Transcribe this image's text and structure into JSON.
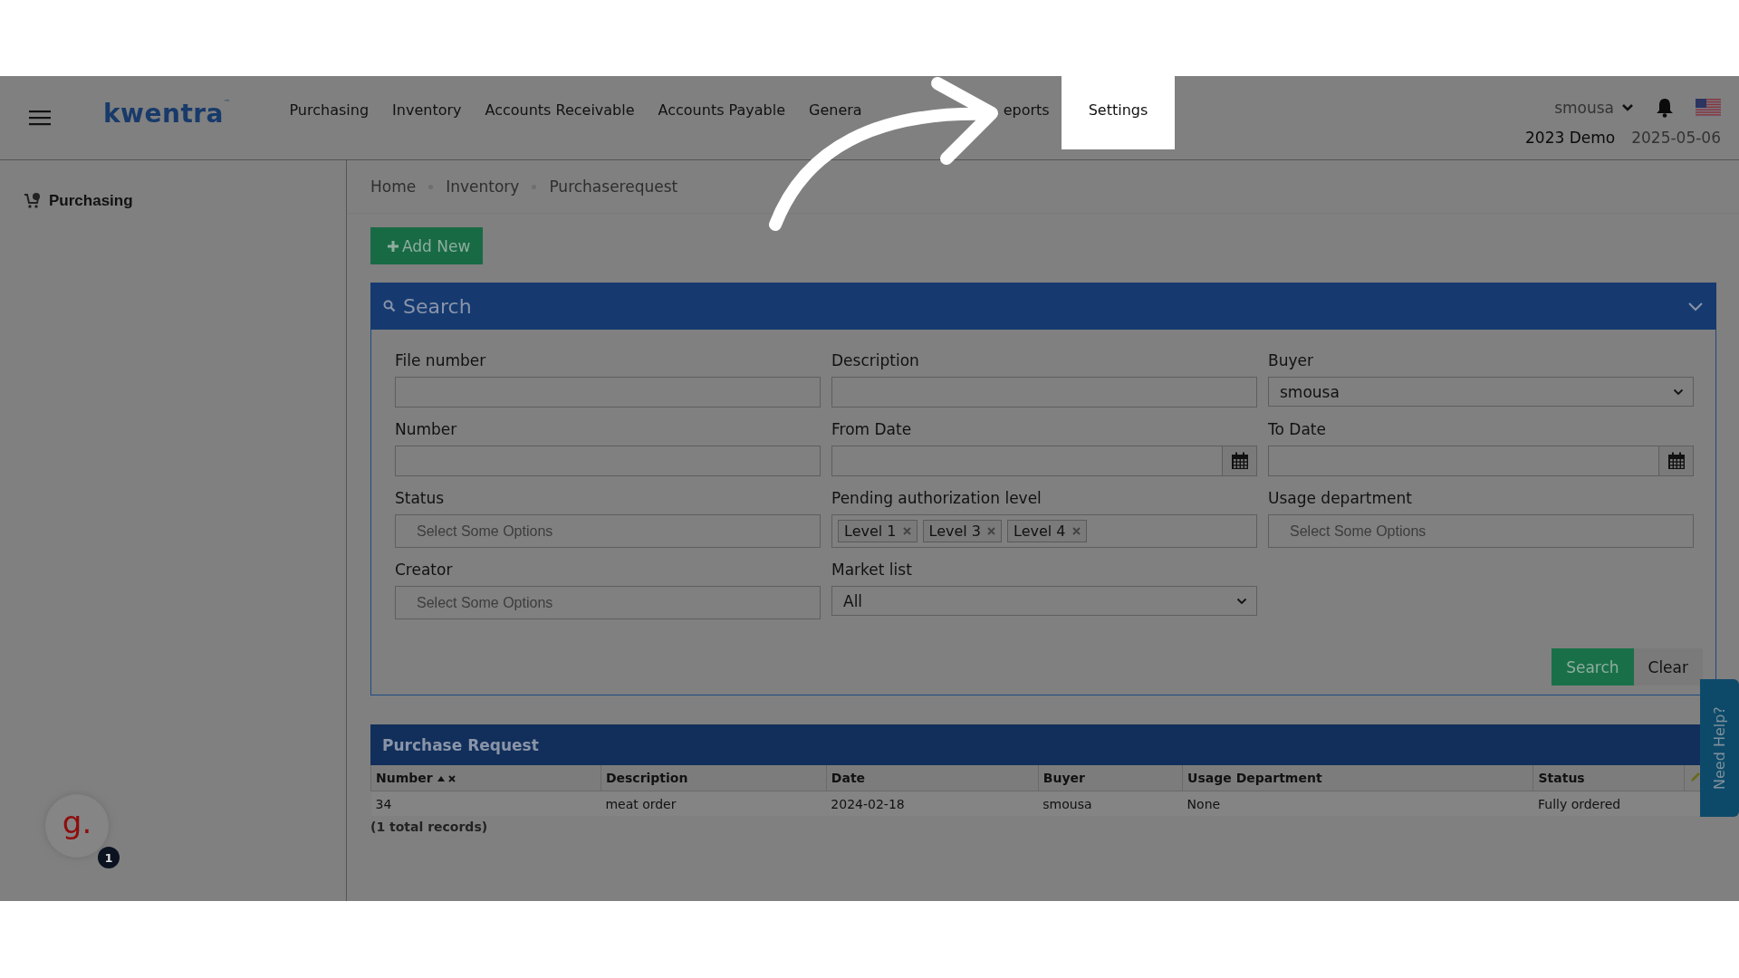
{
  "top_nav": {
    "logo": "kwentra",
    "logo_mark": "™",
    "items": [
      {
        "label": "Purchasing",
        "highlighted": false
      },
      {
        "label": "Inventory",
        "highlighted": false
      },
      {
        "label": "Accounts Receivable",
        "highlighted": false
      },
      {
        "label": "Accounts Payable",
        "highlighted": false
      },
      {
        "label": "Genera",
        "highlighted": false
      },
      {
        "label": "eports",
        "highlighted": false
      },
      {
        "label": "Settings",
        "highlighted": true
      }
    ]
  },
  "user": {
    "name": "smousa",
    "company": "2023 Demo",
    "date": "2025-05-06"
  },
  "sidebar": {
    "items": [
      {
        "label": "Purchasing"
      }
    ]
  },
  "breadcrumb": [
    "Home",
    "Inventory",
    "Purchaserequest"
  ],
  "add_button": "Add New",
  "search_panel": {
    "title": "Search",
    "expanded": true,
    "fields": [
      {
        "label": "File number",
        "kind": "text"
      },
      {
        "label": "Description",
        "kind": "text"
      },
      {
        "label": "Buyer",
        "kind": "select",
        "value": "smousa"
      },
      {
        "label": "Number",
        "kind": "text"
      },
      {
        "label": "From Date",
        "kind": "date"
      },
      {
        "label": "To Date",
        "kind": "date"
      },
      {
        "label": "Status",
        "kind": "multiselect",
        "placeholder": "Select Some Options"
      },
      {
        "label": "Pending authorization level",
        "kind": "multiselect",
        "tags": [
          "Level 1",
          "Level 3",
          "Level 4"
        ]
      },
      {
        "label": "Usage department",
        "kind": "multiselect",
        "placeholder": "Select Some Options"
      },
      {
        "label": "Creator",
        "kind": "multiselect",
        "placeholder": "Select Some Options"
      },
      {
        "label": "Market list",
        "kind": "select",
        "value": "All"
      }
    ],
    "buttons": [
      {
        "label": "Search",
        "kind": "primary"
      },
      {
        "label": "Clear",
        "kind": "secondary"
      }
    ]
  },
  "results": {
    "title": "Purchase Request",
    "columns": [
      {
        "label": "Number",
        "sorted": true
      },
      {
        "label": "Description",
        "sorted": false
      },
      {
        "label": "Date",
        "sorted": false
      },
      {
        "label": "Buyer",
        "sorted": false
      },
      {
        "label": "Usage Department",
        "sorted": false
      },
      {
        "label": "Status",
        "sorted": false
      }
    ],
    "rows": [
      [
        "34",
        "meat order",
        "2024-02-18",
        "smousa",
        "None",
        "Fully ordered"
      ]
    ],
    "total": "(1 total records)"
  },
  "help_tab": "Need Help?",
  "chat_widget": {
    "logo": "g.",
    "badge": "1"
  }
}
